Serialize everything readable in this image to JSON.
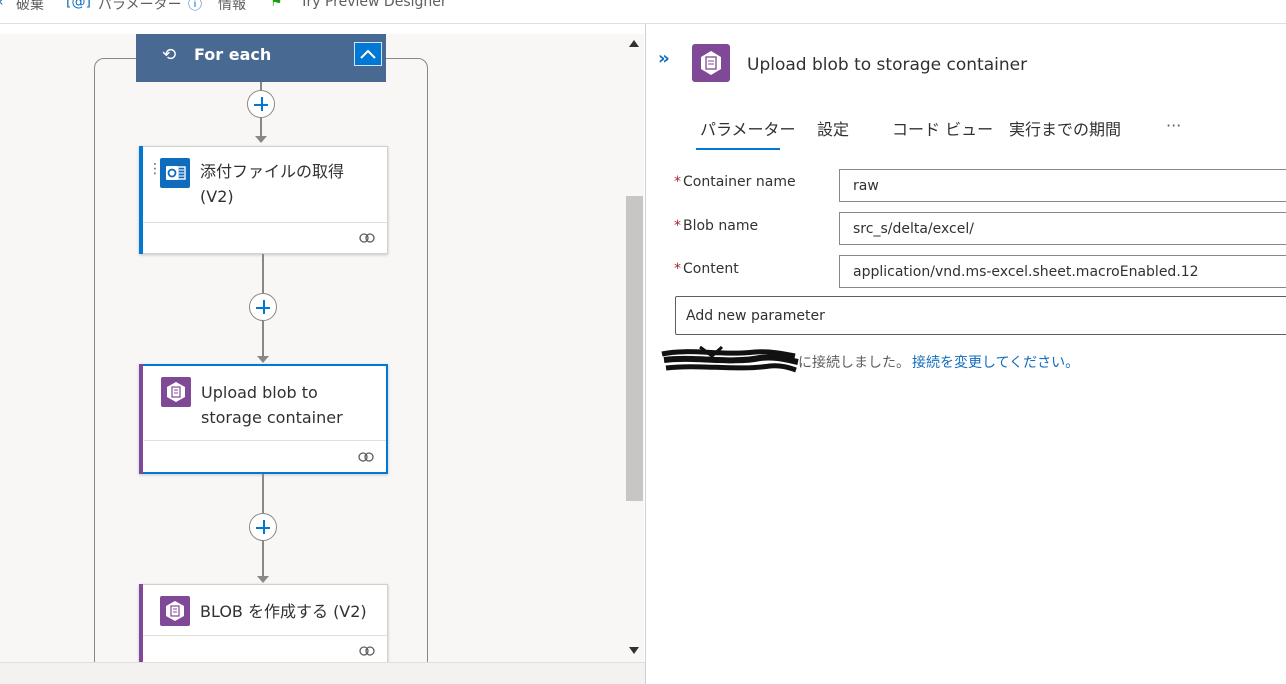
{
  "toolbar": {
    "items": [
      {
        "icon": "chevron-left-icon",
        "label": "破棄"
      },
      {
        "icon": "parameters-icon",
        "label": "パラメーター"
      },
      {
        "icon": "info-icon",
        "label": "情報"
      },
      {
        "icon": "leaf-icon",
        "label": "Try Preview Designer"
      }
    ]
  },
  "canvas": {
    "foreach": {
      "title": "For each",
      "icon": "loop-icon"
    },
    "cards": [
      {
        "title_line1": "添付ファイルの取得",
        "title_line2": "(V2)",
        "icon": "outlook-icon",
        "accent": "#0078d4"
      },
      {
        "title_line1": "Upload blob to",
        "title_line2": "storage container",
        "icon": "storage-blob-icon",
        "accent": "#804998",
        "selected": true
      },
      {
        "title_line1": "BLOB を作成する (V2)",
        "title_line2": "",
        "icon": "storage-blob-icon",
        "accent": "#804998"
      }
    ]
  },
  "panel": {
    "title": "Upload blob to storage container",
    "tabs": [
      "パラメーター",
      "設定",
      "コード ビュー",
      "実行までの期間",
      "···"
    ],
    "active_tab": "パラメーター",
    "fields": [
      {
        "label": "Container name",
        "required": "*",
        "value": "raw"
      },
      {
        "label": "Blob name",
        "required": "*",
        "value": "src_s/delta/excel/"
      },
      {
        "label": "Content",
        "required": "*",
        "value": "application/vnd.ms-excel.sheet.macroEnabled.12"
      }
    ],
    "add_param_placeholder": "Add new parameter",
    "connection_text": "に接続しました。",
    "connection_link": "接続を変更してください。"
  },
  "colors": {
    "accent_blue": "#0078d4",
    "foreach_header": "#486991",
    "storage_purple": "#804998",
    "outlook_blue": "#0f6cbd"
  }
}
